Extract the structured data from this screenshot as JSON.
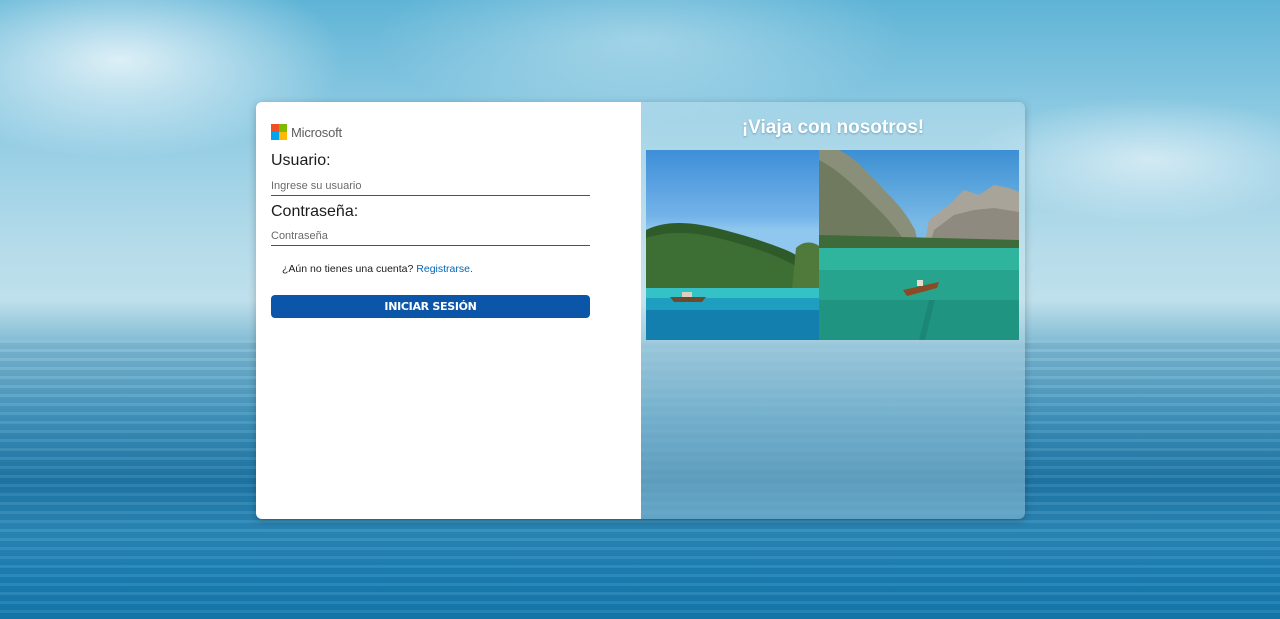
{
  "login": {
    "brand": "Microsoft",
    "username_label": "Usuario:",
    "username_placeholder": "Ingrese su usuario",
    "password_label": "Contraseña:",
    "password_placeholder": "Contraseña",
    "no_account_text": "¿Aún no tienes una cuenta?",
    "register_link": "Registrarse.",
    "submit_label": "INICIAR SESIÓN"
  },
  "promo": {
    "title": "¡Viaja con nosotros!",
    "images": [
      "tropical-island-boat-photo",
      "mountain-lake-boat-photo"
    ]
  },
  "colors": {
    "accent": "#0b56a8",
    "link": "#0067b8",
    "ms_red": "#f25022",
    "ms_green": "#7fba00",
    "ms_blue": "#00a4ef",
    "ms_yellow": "#ffb900"
  },
  "icons": [
    "microsoft-logo-icon"
  ]
}
